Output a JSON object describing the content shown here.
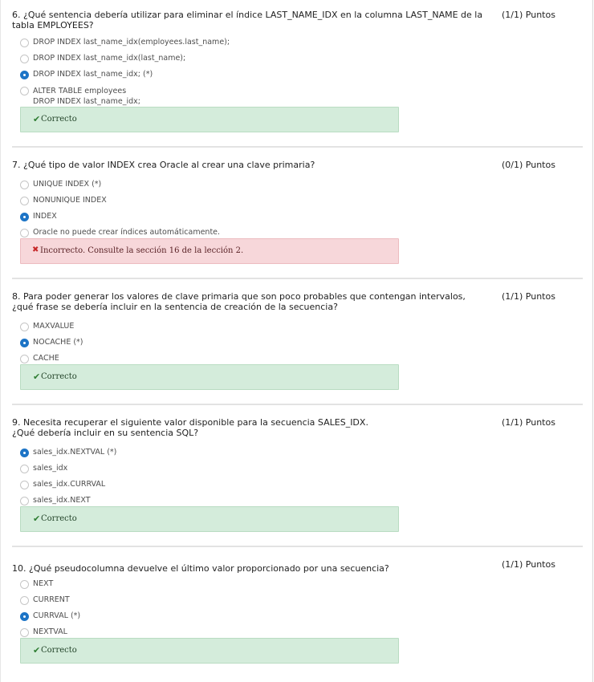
{
  "questions": [
    {
      "text": "6. ¿Qué sentencia debería utilizar para eliminar el índice LAST_NAME_IDX en la columna LAST_NAME de la tabla EMPLOYEES?",
      "points": "(1/1) Puntos",
      "options": [
        {
          "label": "DROP INDEX last_name_idx(employees.last_name);",
          "selected": false
        },
        {
          "label": "DROP INDEX last_name_idx(last_name);",
          "selected": false
        },
        {
          "label": "DROP INDEX last_name_idx; (*)",
          "selected": true
        },
        {
          "label": "ALTER TABLE employees\nDROP INDEX last_name_idx;",
          "selected": false
        }
      ],
      "feedback": {
        "icon": "check-icon",
        "text": "Correcto",
        "status": "correct"
      }
    },
    {
      "text": "7. ¿Qué tipo de valor INDEX crea Oracle al crear una clave primaria?",
      "points": "(0/1) Puntos",
      "options": [
        {
          "label": "UNIQUE INDEX (*)",
          "selected": false
        },
        {
          "label": "NONUNIQUE INDEX",
          "selected": false
        },
        {
          "label": "INDEX",
          "selected": true
        },
        {
          "label": "Oracle no puede crear índices automáticamente.",
          "selected": false
        }
      ],
      "feedback": {
        "icon": "cross-icon",
        "text": "Incorrecto. Consulte la sección 16 de la lección 2.",
        "status": "incorrect"
      }
    },
    {
      "text": "8. Para poder generar los valores de clave primaria que son poco probables que contengan intervalos, ¿qué frase se debería incluir en la sentencia de creación de la secuencia?",
      "points": "(1/1) Puntos",
      "options": [
        {
          "label": "MAXVALUE",
          "selected": false
        },
        {
          "label": "NOCACHE (*)",
          "selected": true
        },
        {
          "label": "CACHE",
          "selected": false
        }
      ],
      "feedback": {
        "icon": "check-icon",
        "text": "Correcto",
        "status": "correct"
      }
    },
    {
      "text": "9. Necesita recuperar el siguiente valor disponible para la secuencia SALES_IDX.\n¿Qué debería incluir en su sentencia SQL?",
      "points": "(1/1) Puntos",
      "options": [
        {
          "label": "sales_idx.NEXTVAL (*)",
          "selected": true
        },
        {
          "label": "sales_idx",
          "selected": false
        },
        {
          "label": "sales_idx.CURRVAL",
          "selected": false
        },
        {
          "label": "sales_idx.NEXT",
          "selected": false
        }
      ],
      "feedback": {
        "icon": "check-icon",
        "text": "Correcto",
        "status": "correct"
      }
    },
    {
      "text": "10. ¿Qué pseudocolumna devuelve el último valor proporcionado por una secuencia?",
      "points": "(1/1) Puntos",
      "options": [
        {
          "label": "NEXT",
          "selected": false
        },
        {
          "label": "CURRENT",
          "selected": false
        },
        {
          "label": "CURRVAL (*)",
          "selected": true
        },
        {
          "label": "NEXTVAL",
          "selected": false
        }
      ],
      "feedback": {
        "icon": "check-icon",
        "text": "Correcto",
        "status": "correct"
      }
    }
  ],
  "colors": {
    "correct_bg": "#d4ecdb",
    "incorrect_bg": "#f7d7da",
    "radio_selected": "#1d74c6"
  }
}
